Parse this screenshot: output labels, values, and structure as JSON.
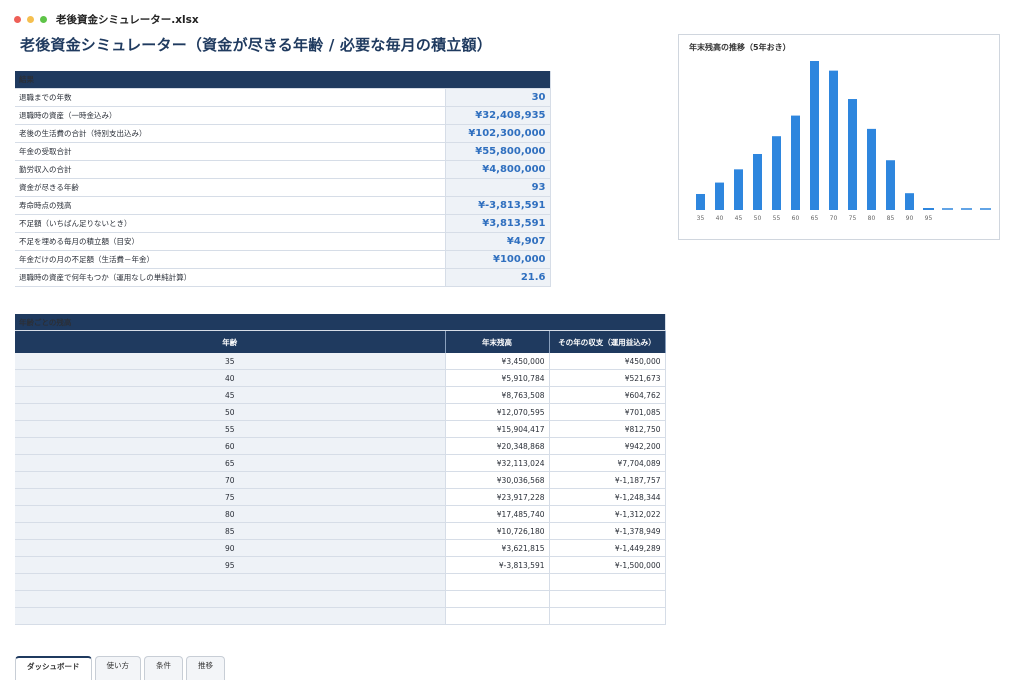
{
  "window": {
    "filename": "老後資金シミュレーター.xlsx"
  },
  "sheet_title": "老後資金シミュレーター（資金が尽きる年齢 / 必要な毎月の積立額）",
  "results": {
    "header": "結果",
    "rows": [
      {
        "label": "退職までの年数",
        "value": "30"
      },
      {
        "label": "退職時の資産（一時金込み）",
        "value": "¥32,408,935"
      },
      {
        "label": "老後の生活費の合計（特別支出込み）",
        "value": "¥102,300,000"
      },
      {
        "label": "年金の受取合計",
        "value": "¥55,800,000"
      },
      {
        "label": "勤労収入の合計",
        "value": "¥4,800,000"
      },
      {
        "label": "資金が尽きる年齢",
        "value": "93"
      },
      {
        "label": "寿命時点の残高",
        "value": "¥-3,813,591"
      },
      {
        "label": "不足額（いちばん足りないとき）",
        "value": "¥3,813,591"
      },
      {
        "label": "不足を埋める毎月の積立額（目安）",
        "value": "¥4,907"
      },
      {
        "label": "年金だけの月の不足額（生活費－年金）",
        "value": "¥100,000"
      },
      {
        "label": "退職時の資産で何年もつか（運用なしの単純計算）",
        "value": "21.6"
      }
    ]
  },
  "balance_table": {
    "header": "年齢ごとの残高",
    "columns": [
      "年齢",
      "年末残高",
      "その年の収支（運用益込み）"
    ],
    "rows": [
      [
        "35",
        "¥3,450,000",
        "¥450,000"
      ],
      [
        "40",
        "¥5,910,784",
        "¥521,673"
      ],
      [
        "45",
        "¥8,763,508",
        "¥604,762"
      ],
      [
        "50",
        "¥12,070,595",
        "¥701,085"
      ],
      [
        "55",
        "¥15,904,417",
        "¥812,750"
      ],
      [
        "60",
        "¥20,348,868",
        "¥942,200"
      ],
      [
        "65",
        "¥32,113,024",
        "¥7,704,089"
      ],
      [
        "70",
        "¥30,036,568",
        "¥-1,187,757"
      ],
      [
        "75",
        "¥23,917,228",
        "¥-1,248,344"
      ],
      [
        "80",
        "¥17,485,740",
        "¥-1,312,022"
      ],
      [
        "85",
        "¥10,726,180",
        "¥-1,378,949"
      ],
      [
        "90",
        "¥3,621,815",
        "¥-1,449,289"
      ],
      [
        "95",
        "¥-3,813,591",
        "¥-1,500,000"
      ],
      [
        "",
        "",
        ""
      ],
      [
        "",
        "",
        ""
      ],
      [
        "",
        "",
        ""
      ]
    ]
  },
  "chart_data": {
    "type": "bar",
    "title": "年末残高の推移（5年おき）",
    "categories": [
      "35",
      "40",
      "45",
      "50",
      "55",
      "60",
      "65",
      "70",
      "75",
      "80",
      "85",
      "90",
      "95",
      "",
      "",
      ""
    ],
    "values": [
      3450000,
      5910784,
      8763508,
      12070595,
      15904417,
      20348868,
      32113024,
      30036568,
      23917228,
      17485740,
      10726180,
      3621815,
      -3813591,
      0,
      0,
      0
    ],
    "color": "#2e86de",
    "grid": false,
    "legend": "none"
  },
  "tabs": [
    {
      "label": "ダッシュボード",
      "active": true
    },
    {
      "label": "使い方",
      "active": false
    },
    {
      "label": "条件",
      "active": false
    },
    {
      "label": "推移",
      "active": false
    }
  ]
}
